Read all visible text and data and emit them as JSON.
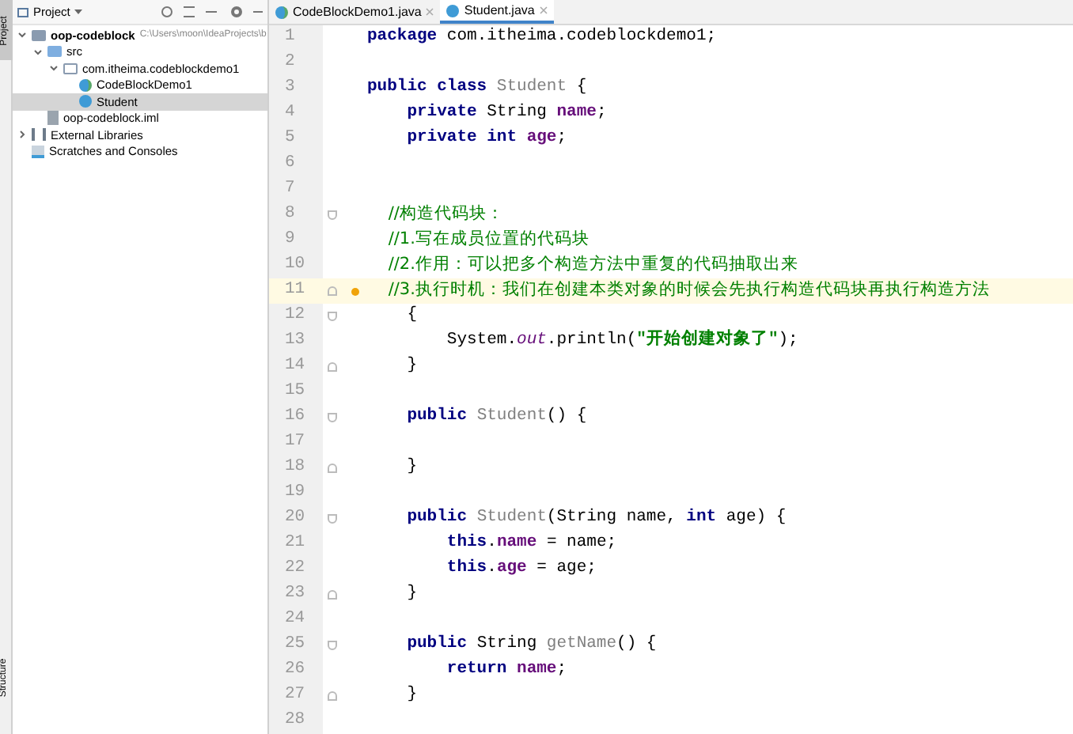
{
  "tool_strip": {
    "top": "Project",
    "bottom": "Structure"
  },
  "project_panel": {
    "title": "Project",
    "tree": [
      {
        "label": "oop-codeblock",
        "hint": "C:\\Users\\moon\\IdeaProjects\\b",
        "kind": "module",
        "expanded": true,
        "selected": false,
        "children": [
          {
            "label": "src",
            "kind": "folder",
            "expanded": true,
            "selected": false,
            "children": [
              {
                "label": "com.itheima.codeblockdemo1",
                "kind": "package",
                "expanded": true,
                "selected": false,
                "children": [
                  {
                    "label": "CodeBlockDemo1",
                    "kind": "main-class",
                    "selected": false
                  },
                  {
                    "label": "Student",
                    "kind": "class",
                    "selected": true
                  }
                ]
              }
            ]
          },
          {
            "label": "oop-codeblock.iml",
            "kind": "file",
            "selected": false
          }
        ]
      },
      {
        "label": "External Libraries",
        "kind": "library",
        "expanded": false,
        "selected": false
      },
      {
        "label": "Scratches and Consoles",
        "kind": "scratch",
        "selected": false
      }
    ]
  },
  "tabs": [
    {
      "label": "CodeBlockDemo1.java",
      "kind": "main-class",
      "selected": false
    },
    {
      "label": "Student.java",
      "kind": "class",
      "selected": true
    }
  ],
  "editor": {
    "lines": [
      {
        "number": "1",
        "tokens": [
          {
            "kind": "keyword",
            "text": "package "
          },
          {
            "kind": "plain",
            "text": "com.itheima.codeblockdemo1;"
          }
        ]
      },
      {
        "number": "2"
      },
      {
        "number": "3",
        "tokens": [
          {
            "kind": "keyword",
            "text": "public class "
          },
          {
            "kind": "type",
            "text": "Student"
          },
          {
            "kind": "plain",
            "text": " {"
          }
        ]
      },
      {
        "number": "4",
        "tokens": [
          {
            "kind": "keyword",
            "text": "    private "
          },
          {
            "kind": "plain",
            "text": "String "
          },
          {
            "kind": "field",
            "text": "name"
          },
          {
            "kind": "plain",
            "text": ";"
          }
        ]
      },
      {
        "number": "5",
        "tokens": [
          {
            "kind": "keyword",
            "text": "    private int "
          },
          {
            "kind": "field",
            "text": "age"
          },
          {
            "kind": "plain",
            "text": ";"
          }
        ]
      },
      {
        "number": "6"
      },
      {
        "number": "7"
      },
      {
        "number": "8",
        "fold_start": true,
        "tokens": [
          {
            "kind": "comment",
            "text": "    //构造代码块："
          }
        ]
      },
      {
        "number": "9",
        "tokens": [
          {
            "kind": "comment",
            "text": "    //1.写在成员位置的代码块"
          }
        ]
      },
      {
        "number": "10",
        "tokens": [
          {
            "kind": "comment",
            "text": "    //2.作用：可以把多个构造方法中重复的代码抽取出来"
          }
        ]
      },
      {
        "number": "11",
        "fold_end": true,
        "bulb": true,
        "highlighted": true,
        "tokens": [
          {
            "kind": "comment",
            "text": "    //3.执行时机：我们在创建本类对象的时候会先执行构造代码块再执行构造方法"
          }
        ]
      },
      {
        "number": "12",
        "fold_start": true,
        "tokens": [
          {
            "kind": "plain",
            "text": "    {"
          }
        ]
      },
      {
        "number": "13",
        "tokens": [
          {
            "kind": "plain",
            "text": "        System."
          },
          {
            "kind": "static",
            "text": "out"
          },
          {
            "kind": "plain",
            "text": ".println("
          },
          {
            "kind": "string",
            "text": "\"开始创建对象了\""
          },
          {
            "kind": "plain",
            "text": ");"
          }
        ]
      },
      {
        "number": "14",
        "fold_end": true,
        "tokens": [
          {
            "kind": "plain",
            "text": "    }"
          }
        ]
      },
      {
        "number": "15"
      },
      {
        "number": "16",
        "fold_start": true,
        "tokens": [
          {
            "kind": "keyword",
            "text": "    public "
          },
          {
            "kind": "type",
            "text": "Student"
          },
          {
            "kind": "plain",
            "text": "() {"
          }
        ]
      },
      {
        "number": "17"
      },
      {
        "number": "18",
        "fold_end": true,
        "tokens": [
          {
            "kind": "plain",
            "text": "    }"
          }
        ]
      },
      {
        "number": "19"
      },
      {
        "number": "20",
        "fold_start": true,
        "tokens": [
          {
            "kind": "keyword",
            "text": "    public "
          },
          {
            "kind": "type",
            "text": "Student"
          },
          {
            "kind": "plain",
            "text": "(String name, "
          },
          {
            "kind": "keyword",
            "text": "int "
          },
          {
            "kind": "plain",
            "text": "age) {"
          }
        ]
      },
      {
        "number": "21",
        "tokens": [
          {
            "kind": "keyword",
            "text": "        this"
          },
          {
            "kind": "plain",
            "text": "."
          },
          {
            "kind": "field",
            "text": "name"
          },
          {
            "kind": "plain",
            "text": " = name;"
          }
        ]
      },
      {
        "number": "22",
        "tokens": [
          {
            "kind": "keyword",
            "text": "        this"
          },
          {
            "kind": "plain",
            "text": "."
          },
          {
            "kind": "field",
            "text": "age"
          },
          {
            "kind": "plain",
            "text": " = age;"
          }
        ]
      },
      {
        "number": "23",
        "fold_end": true,
        "tokens": [
          {
            "kind": "plain",
            "text": "    }"
          }
        ]
      },
      {
        "number": "24"
      },
      {
        "number": "25",
        "fold_start": true,
        "tokens": [
          {
            "kind": "keyword",
            "text": "    public "
          },
          {
            "kind": "plain",
            "text": "String "
          },
          {
            "kind": "type",
            "text": "getName"
          },
          {
            "kind": "plain",
            "text": "() {"
          }
        ]
      },
      {
        "number": "26",
        "tokens": [
          {
            "kind": "keyword",
            "text": "        return "
          },
          {
            "kind": "field",
            "text": "name"
          },
          {
            "kind": "plain",
            "text": ";"
          }
        ]
      },
      {
        "number": "27",
        "fold_end": true,
        "tokens": [
          {
            "kind": "plain",
            "text": "    }"
          }
        ]
      },
      {
        "number": "28"
      }
    ]
  }
}
